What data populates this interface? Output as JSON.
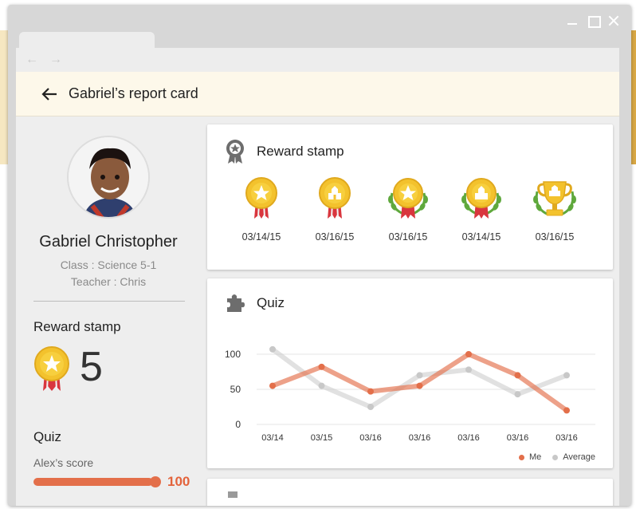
{
  "app": {
    "title": "Gabriel’s report card"
  },
  "student": {
    "name": "Gabriel Christopher",
    "class": "Class : Science 5-1",
    "teacher": "Teacher : Chris"
  },
  "sidebar": {
    "reward_label": "Reward stamp",
    "reward_count": "5",
    "quiz_label": "Quiz",
    "score_label": "Alex’s score",
    "score_value": "100"
  },
  "reward_card": {
    "title": "Reward stamp",
    "stamps": [
      {
        "date": "03/14/15",
        "type": "star-medal"
      },
      {
        "date": "03/16/15",
        "type": "building-medal"
      },
      {
        "date": "03/16/15",
        "type": "star-medal-laurel"
      },
      {
        "date": "03/14/15",
        "type": "building-medal-laurel"
      },
      {
        "date": "03/16/15",
        "type": "trophy-laurel"
      }
    ]
  },
  "quiz_card": {
    "title": "Quiz"
  },
  "colors": {
    "me": "#e36f4a",
    "average": "#c8c8c8",
    "gold": "#f3c22d",
    "ribbon": "#d9363e",
    "laurel": "#5fa83c"
  },
  "chart_data": {
    "type": "line",
    "categories": [
      "03/14",
      "03/15",
      "03/16",
      "03/16",
      "03/16",
      "03/16",
      "03/16"
    ],
    "series": [
      {
        "name": "Me",
        "values": [
          55,
          82,
          47,
          55,
          100,
          70,
          20
        ]
      },
      {
        "name": "Average",
        "values": [
          107,
          55,
          25,
          70,
          78,
          43,
          70
        ]
      }
    ],
    "yticks": [
      "100",
      "50",
      "0"
    ],
    "ylim": [
      0,
      110
    ],
    "grid": true,
    "legend": "bottom-right"
  }
}
